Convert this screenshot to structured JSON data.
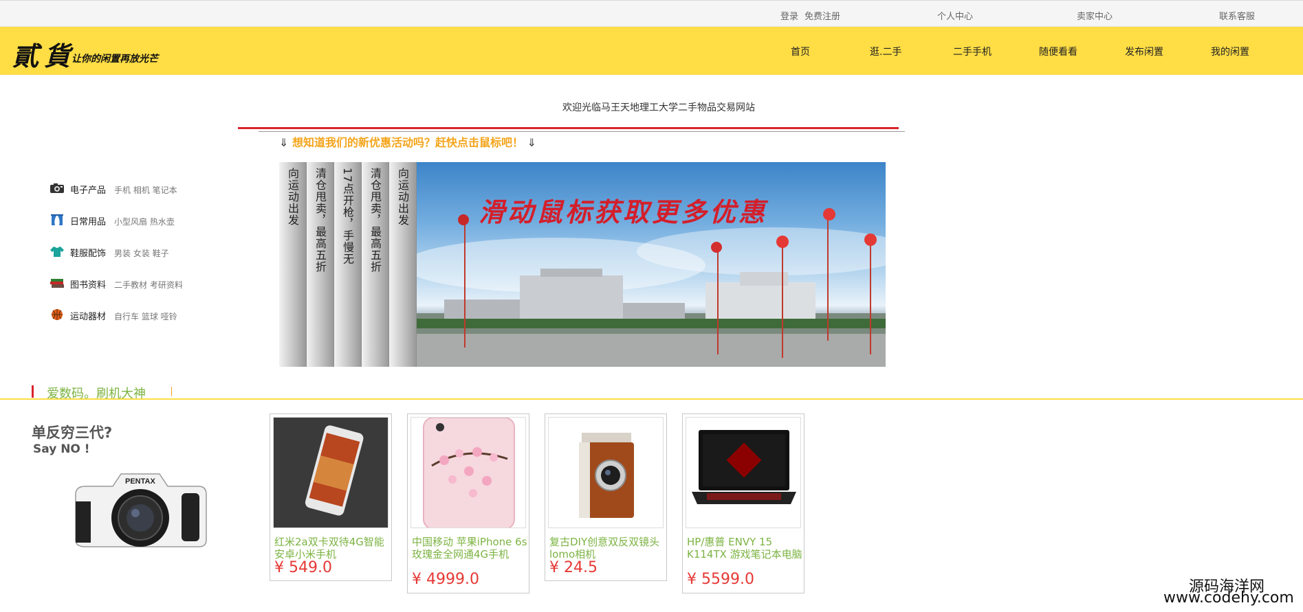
{
  "topbar": {
    "login": "登录",
    "register": "免费注册",
    "personal_center": "个人中心",
    "seller_center": "卖家中心",
    "contact_service": "联系客服"
  },
  "header": {
    "logo_main": "貳貨",
    "logo_slogan": "让你的闲置再放光芒",
    "brand_color": "#fedd45",
    "nav": [
      "首页",
      "逛.二手",
      "二手手机",
      "随便看看",
      "发布闲置",
      "我的闲置"
    ]
  },
  "welcome": "欢迎光临马王天地理工大学二手物品交易网站",
  "promo": {
    "arrow_left": "⇓",
    "text": "想知道我们的新优惠活动吗？赶快点击鼠标吧！",
    "arrow_right": "⇓"
  },
  "categories": [
    {
      "icon": "camera-icon",
      "name": "电子产品",
      "sub": "手机  相机  笔记本"
    },
    {
      "icon": "curtain-icon",
      "name": "日常用品",
      "sub": "小型风扇  热水壶"
    },
    {
      "icon": "clothes-icon",
      "name": "鞋服配饰",
      "sub": "男装  女装  鞋子"
    },
    {
      "icon": "books-icon",
      "name": "图书资料",
      "sub": "二手教材  考研资料"
    },
    {
      "icon": "basketball-icon",
      "name": "运动器材",
      "sub": "自行车  篮球  哑铃"
    }
  ],
  "slider": {
    "tabs": [
      "向运动出发",
      "清仓甩卖，最高五折",
      "17点开枪，手慢无",
      "清仓甩卖，最高五折",
      "向运动出发"
    ],
    "banner_text": "滑动鼠标获取更多优惠"
  },
  "section": {
    "title": "爱数码。刷机大神"
  },
  "ad": {
    "title": "单反穷三代?",
    "subtitle": "Say NO !",
    "camera_brand": "PENTAX"
  },
  "products": [
    {
      "name": "红米2a双卡双待4G智能安卓小米手机",
      "price": "¥ 549.0"
    },
    {
      "name": "中国移动 苹果iPhone 6s 玫瑰金全网通4G手机",
      "price": "¥ 4999.0"
    },
    {
      "name": "复古DIY创意双反双镜头lomo相机",
      "price": "¥ 24.5"
    },
    {
      "name": "HP/惠普 ENVY 15 K114TX 游戏笔记本电脑",
      "price": "¥ 5599.0"
    }
  ],
  "watermark": {
    "line1": "源码海洋网",
    "line2": "www.codehy.com"
  }
}
